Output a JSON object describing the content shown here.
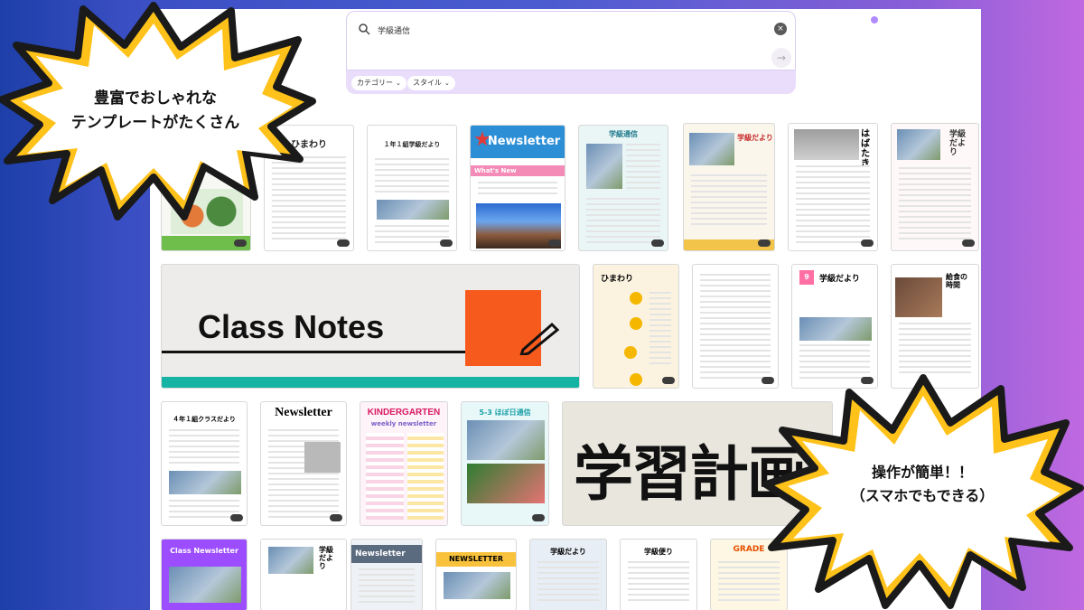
{
  "search": {
    "query": "学級通信",
    "clear_label": "×",
    "submit_label": "→",
    "chips": [
      {
        "label": "カテゴリー"
      },
      {
        "label": "スタイル"
      }
    ]
  },
  "callouts": {
    "top_left": [
      "豊富でおしゃれな",
      "テンプレートがたくさん"
    ],
    "bottom_right": [
      "操作が簡単！！",
      "（スマホでもできる）"
    ]
  },
  "templates": {
    "himawari": "ひまわり",
    "class_news_1": "１年１組学級だより",
    "newsletter_1": "Newsletter",
    "whats_new": "What's New",
    "gakkyu_tsushin": "学級通信",
    "gakkyu_dayori": "学級だより",
    "habataki": "はばたき",
    "gakkyu_dayori_2": "学級だより",
    "class_notes": "Class Notes",
    "himawari_2": "ひまわり",
    "gakkyu_dayori_9": "学級だより",
    "kyushoku": "給食の時間",
    "class_news_4": "４年１組クラスだより",
    "newsletter_2": "Newsletter",
    "kindergarten": "KINDERGARTEN",
    "kindergarten_sub": "weekly newsletter",
    "hobo_nikki": "5-3 ほぼ日通信",
    "gakushu_keikaku": "学習計画",
    "class_newsletter": "Class Newsletter",
    "gakkyu_dayori_3": "学級だより",
    "newsletter_3": "Newsletter",
    "newsletter_4": "NEWSLETTER",
    "gakkyu_dayori_4": "学級だより",
    "gakkyu_dayori_5": "学級便り",
    "grade": "GRADE"
  },
  "colors": {
    "accent_purple": "#e9ddfb",
    "burst_yellow": "#ffc21a",
    "cn_orange": "#f75a1d",
    "cn_teal": "#14b3a3"
  }
}
